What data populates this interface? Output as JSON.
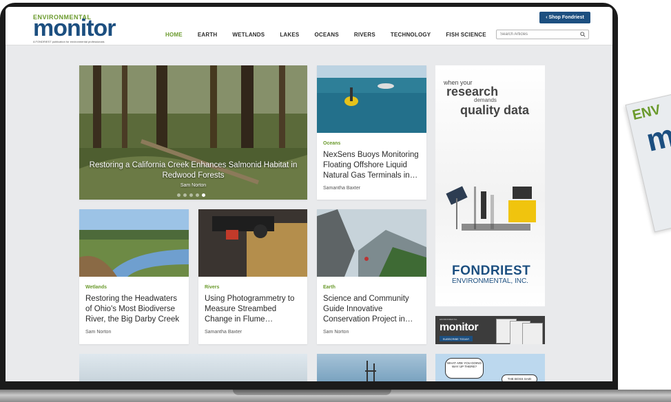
{
  "site": {
    "logo_top": "ENVIRONMENTAL",
    "logo_main": "monitor",
    "logo_sub": "A FONDRIEST publication for environmental professionals",
    "shop_button": "‹ Shop Fondriest",
    "search_placeholder": "Search Articles"
  },
  "nav": {
    "items": [
      {
        "label": "HOME"
      },
      {
        "label": "EARTH"
      },
      {
        "label": "WETLANDS"
      },
      {
        "label": "LAKES"
      },
      {
        "label": "OCEANS"
      },
      {
        "label": "RIVERS"
      },
      {
        "label": "TECHNOLOGY"
      },
      {
        "label": "FISH SCIENCE"
      }
    ]
  },
  "hero": {
    "title": "Restoring a California Creek Enhances Salmonid Habitat in Redwood Forests",
    "author": "Sam Norton",
    "dots": 5,
    "active_dot": 5
  },
  "cards": [
    {
      "category": "Oceans",
      "title": "NexSens Buoys Monitoring Floating Offshore Liquid Natural Gas Terminals in…",
      "author": "Samantha Baxter"
    },
    {
      "category": "Wetlands",
      "title": "Restoring the Headwaters of Ohio's Most Biodiverse River, the Big Darby Creek",
      "author": "Sam Norton"
    },
    {
      "category": "Rivers",
      "title": "Using Photogrammetry to Measure Streambed Change in Flume…",
      "author": "Samantha Baxter"
    },
    {
      "category": "Earth",
      "title": "Science and Community Guide Innovative Conservation Project in…",
      "author": "Sam Norton"
    }
  ],
  "ad": {
    "line1": "when your",
    "line2": "research",
    "line3": "demands",
    "line4": "quality data",
    "brand1": "FONDRIEST",
    "brand2": "ENVIRONMENTAL, INC."
  },
  "banner": {
    "mini": "ENVIRONMENTAL",
    "logo": "monitor",
    "button": "SUBSCRIBE TODAY!"
  },
  "comic": {
    "bubble1": "WHAT ARE YOU DOING WAY UP THERE?",
    "bubble2": "THE BOSS SAID"
  },
  "side_magazine": {
    "top": "ENV",
    "letter": "m"
  },
  "colors": {
    "brand_blue": "#1c4f80",
    "accent_green": "#6a9a2c"
  }
}
